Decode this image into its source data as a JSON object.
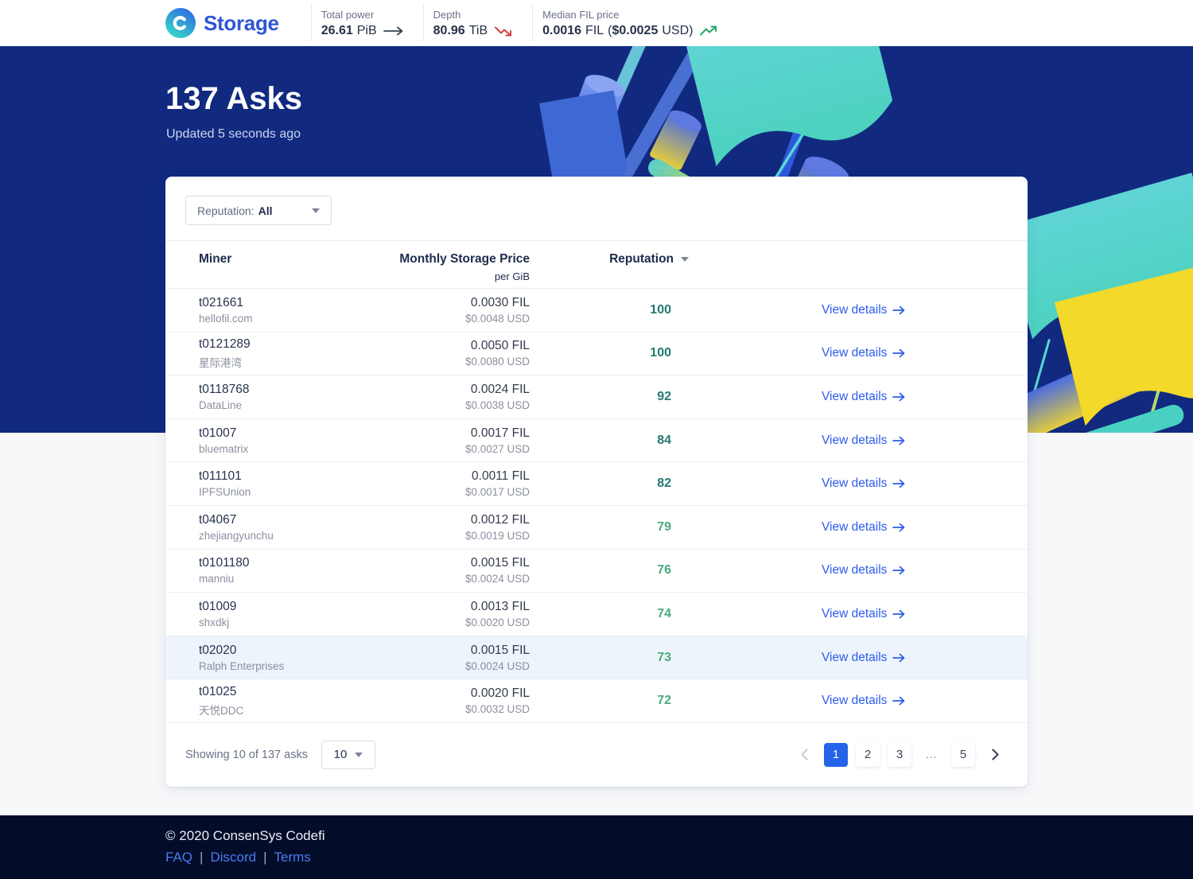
{
  "header": {
    "brand": "Storage",
    "stats": [
      {
        "label": "Total power",
        "value": "26.61",
        "unit": "PiB",
        "trend": "flat"
      },
      {
        "label": "Depth",
        "value": "80.96",
        "unit": "TiB",
        "trend": "down"
      },
      {
        "label": "Median FIL price",
        "value": "0.0016",
        "unit": "FIL",
        "paren_open": "(",
        "value2": "$0.0025",
        "unit2": "USD)",
        "trend": "up"
      }
    ]
  },
  "hero": {
    "title": "137 Asks",
    "updated": "Updated 5 seconds ago"
  },
  "filters": {
    "reputation_label": "Reputation:",
    "reputation_value": "All"
  },
  "table": {
    "columns": {
      "miner": "Miner",
      "price": "Monthly Storage Price",
      "price_sub": "per GiB",
      "reputation": "Reputation"
    },
    "view_details_label": "View details",
    "rows": [
      {
        "miner_id": "t021661",
        "miner_name": "hellofil.com",
        "price_fil": "0.0030 FIL",
        "price_usd": "$0.0048 USD",
        "reputation": "100",
        "tier": "high",
        "highlighted": false
      },
      {
        "miner_id": "t0121289",
        "miner_name": "星际港湾",
        "price_fil": "0.0050 FIL",
        "price_usd": "$0.0080 USD",
        "reputation": "100",
        "tier": "high",
        "highlighted": false
      },
      {
        "miner_id": "t0118768",
        "miner_name": "DataLine",
        "price_fil": "0.0024 FIL",
        "price_usd": "$0.0038 USD",
        "reputation": "92",
        "tier": "high",
        "highlighted": false
      },
      {
        "miner_id": "t01007",
        "miner_name": "bluematrix",
        "price_fil": "0.0017 FIL",
        "price_usd": "$0.0027 USD",
        "reputation": "84",
        "tier": "high",
        "highlighted": false
      },
      {
        "miner_id": "t011101",
        "miner_name": "IPFSUnion",
        "price_fil": "0.0011 FIL",
        "price_usd": "$0.0017 USD",
        "reputation": "82",
        "tier": "high",
        "highlighted": false
      },
      {
        "miner_id": "t04067",
        "miner_name": "zhejiangyunchu",
        "price_fil": "0.0012 FIL",
        "price_usd": "$0.0019 USD",
        "reputation": "79",
        "tier": "medium",
        "highlighted": false
      },
      {
        "miner_id": "t0101180",
        "miner_name": "manniu",
        "price_fil": "0.0015 FIL",
        "price_usd": "$0.0024 USD",
        "reputation": "76",
        "tier": "medium",
        "highlighted": false
      },
      {
        "miner_id": "t01009",
        "miner_name": "shxdkj",
        "price_fil": "0.0013 FIL",
        "price_usd": "$0.0020 USD",
        "reputation": "74",
        "tier": "medium",
        "highlighted": false
      },
      {
        "miner_id": "t02020",
        "miner_name": "Ralph Enterprises",
        "price_fil": "0.0015 FIL",
        "price_usd": "$0.0024 USD",
        "reputation": "73",
        "tier": "medium",
        "highlighted": true
      },
      {
        "miner_id": "t01025",
        "miner_name": "天悦DDC",
        "price_fil": "0.0020 FIL",
        "price_usd": "$0.0032 USD",
        "reputation": "72",
        "tier": "medium",
        "highlighted": false
      }
    ]
  },
  "pagination": {
    "summary": "Showing 10 of 137 asks",
    "page_size": "10",
    "pages": [
      "1",
      "2",
      "3",
      "…",
      "5"
    ],
    "active_page": "1"
  },
  "footer": {
    "copyright": "© 2020 ConsenSys Codefi",
    "links": [
      "FAQ",
      "Discord",
      "Terms"
    ],
    "separator": "|"
  },
  "colors": {
    "hero_navy": "#112a80",
    "footer_navy": "#030d2a",
    "accent_blue": "#2d5bea",
    "active_page_blue": "#2563e8",
    "reputation_high": "#22796e",
    "reputation_medium": "#4caa7d",
    "trend_up_green": "#27a568",
    "trend_down_red": "#d64045",
    "row_highlight": "#edf4fc"
  }
}
